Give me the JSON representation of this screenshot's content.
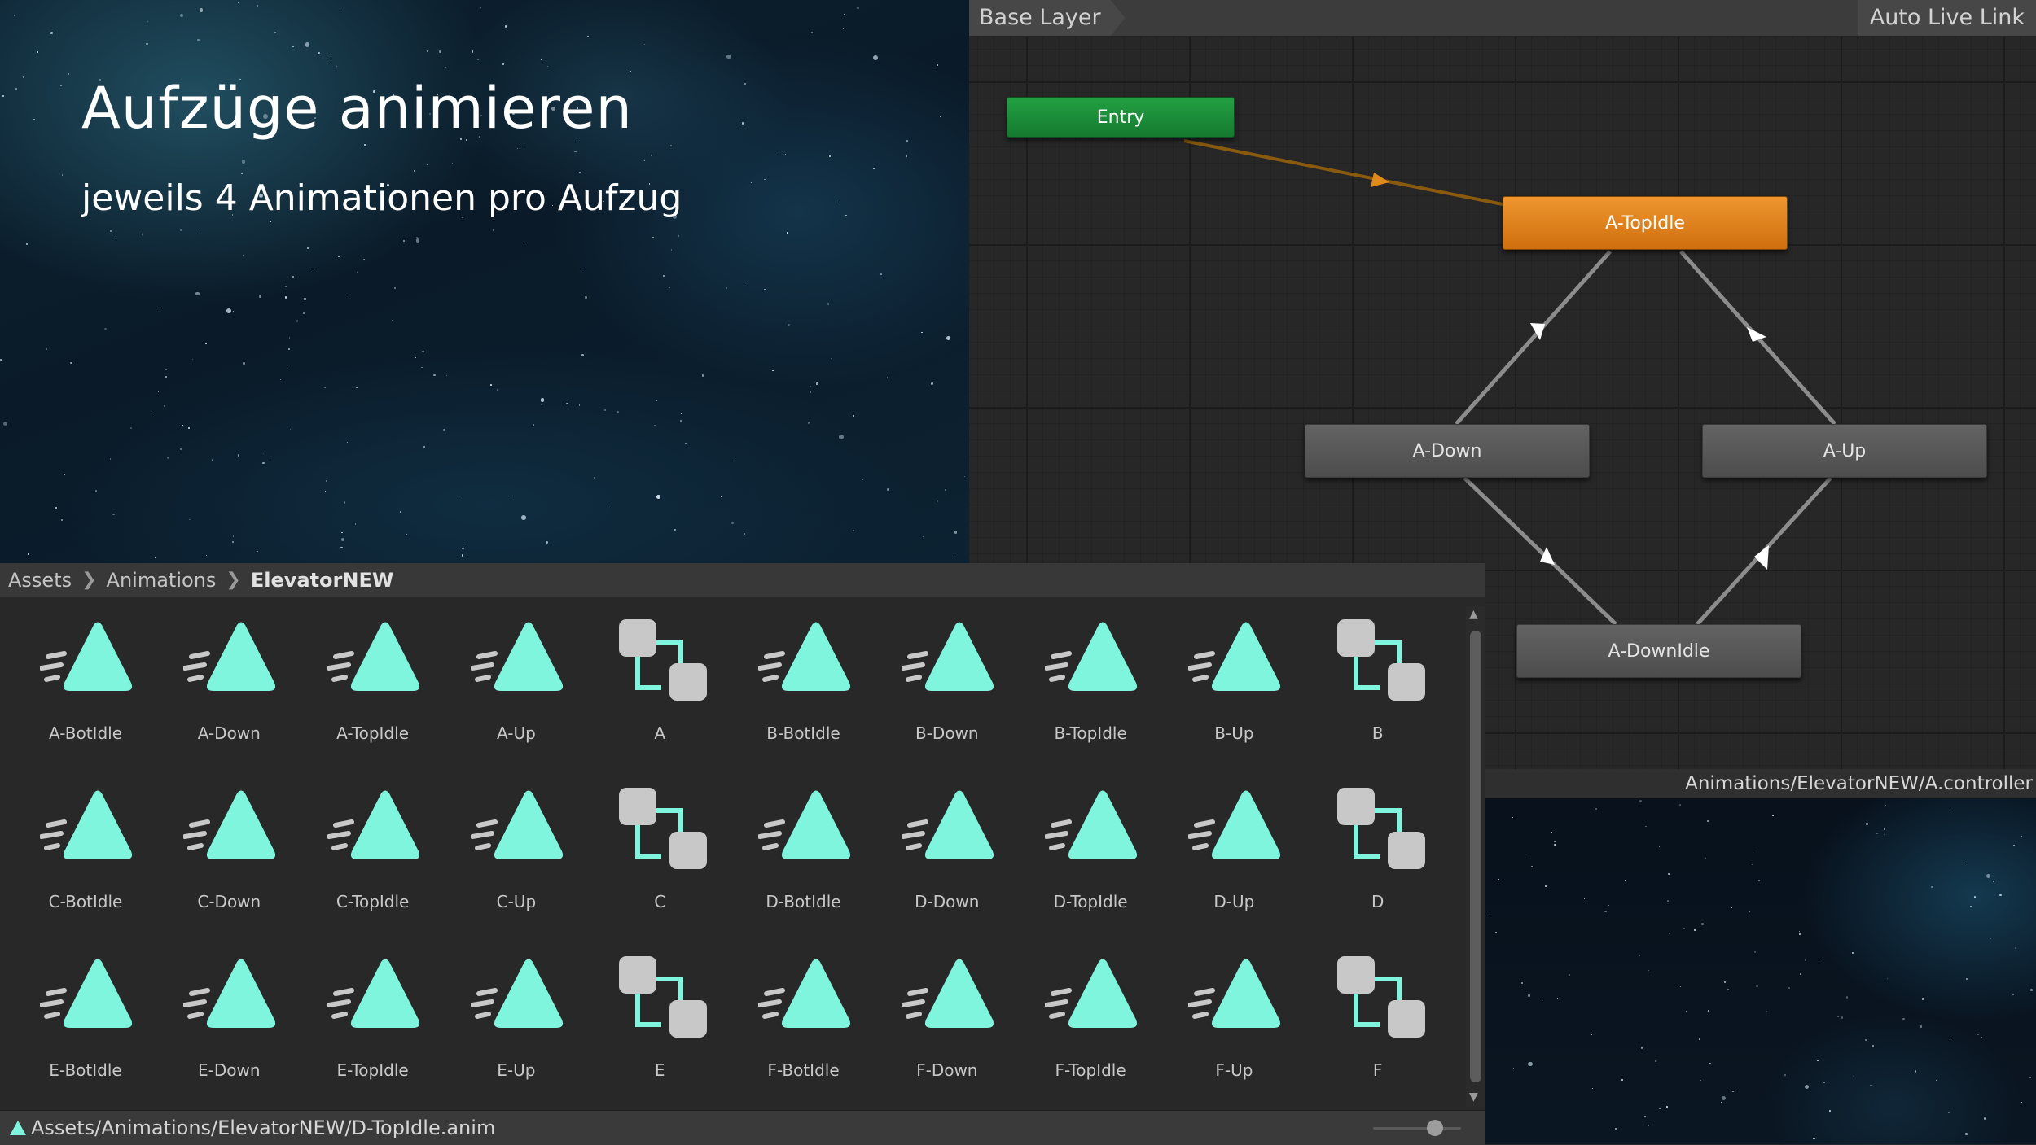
{
  "slide": {
    "title": "Aufzüge animieren",
    "subtitle": "jeweils 4 Animationen pro Aufzug"
  },
  "animator": {
    "layer": "Base Layer",
    "auto_live_link": "Auto Live Link",
    "states": {
      "entry": "Entry",
      "top_idle": "A-TopIdle",
      "down": "A-Down",
      "up": "A-Up",
      "down_idle": "A-DownIdle"
    }
  },
  "preview": {
    "path": "Animations/ElevatorNEW/A.controller"
  },
  "project": {
    "breadcrumb": [
      "Assets",
      "Animations",
      "ElevatorNEW"
    ],
    "assets": [
      {
        "label": "A-BotIdle",
        "icon": "animation-clip-icon"
      },
      {
        "label": "A-Down",
        "icon": "animation-clip-icon"
      },
      {
        "label": "A-TopIdle",
        "icon": "animation-clip-icon"
      },
      {
        "label": "A-Up",
        "icon": "animation-clip-icon"
      },
      {
        "label": "A",
        "icon": "animator-controller-icon"
      },
      {
        "label": "B-BotIdle",
        "icon": "animation-clip-icon"
      },
      {
        "label": "B-Down",
        "icon": "animation-clip-icon"
      },
      {
        "label": "B-TopIdle",
        "icon": "animation-clip-icon"
      },
      {
        "label": "B-Up",
        "icon": "animation-clip-icon"
      },
      {
        "label": "B",
        "icon": "animator-controller-icon"
      },
      {
        "label": "C-BotIdle",
        "icon": "animation-clip-icon"
      },
      {
        "label": "C-Down",
        "icon": "animation-clip-icon"
      },
      {
        "label": "C-TopIdle",
        "icon": "animation-clip-icon"
      },
      {
        "label": "C-Up",
        "icon": "animation-clip-icon"
      },
      {
        "label": "C",
        "icon": "animator-controller-icon"
      },
      {
        "label": "D-BotIdle",
        "icon": "animation-clip-icon"
      },
      {
        "label": "D-Down",
        "icon": "animation-clip-icon"
      },
      {
        "label": "D-TopIdle",
        "icon": "animation-clip-icon"
      },
      {
        "label": "D-Up",
        "icon": "animation-clip-icon"
      },
      {
        "label": "D",
        "icon": "animator-controller-icon"
      },
      {
        "label": "E-BotIdle",
        "icon": "animation-clip-icon"
      },
      {
        "label": "E-Down",
        "icon": "animation-clip-icon"
      },
      {
        "label": "E-TopIdle",
        "icon": "animation-clip-icon"
      },
      {
        "label": "E-Up",
        "icon": "animation-clip-icon"
      },
      {
        "label": "E",
        "icon": "animator-controller-icon"
      },
      {
        "label": "F-BotIdle",
        "icon": "animation-clip-icon"
      },
      {
        "label": "F-Down",
        "icon": "animation-clip-icon"
      },
      {
        "label": "F-TopIdle",
        "icon": "animation-clip-icon"
      },
      {
        "label": "F-Up",
        "icon": "animation-clip-icon"
      },
      {
        "label": "F",
        "icon": "animator-controller-icon"
      }
    ],
    "status_path": "Assets/Animations/ElevatorNEW/D-TopIdle.anim"
  },
  "colors": {
    "clip_icon": "#7ff5dd",
    "controller_box": "#c8c8c8",
    "default_state": "#e5851f",
    "entry_state": "#1b8c38"
  }
}
